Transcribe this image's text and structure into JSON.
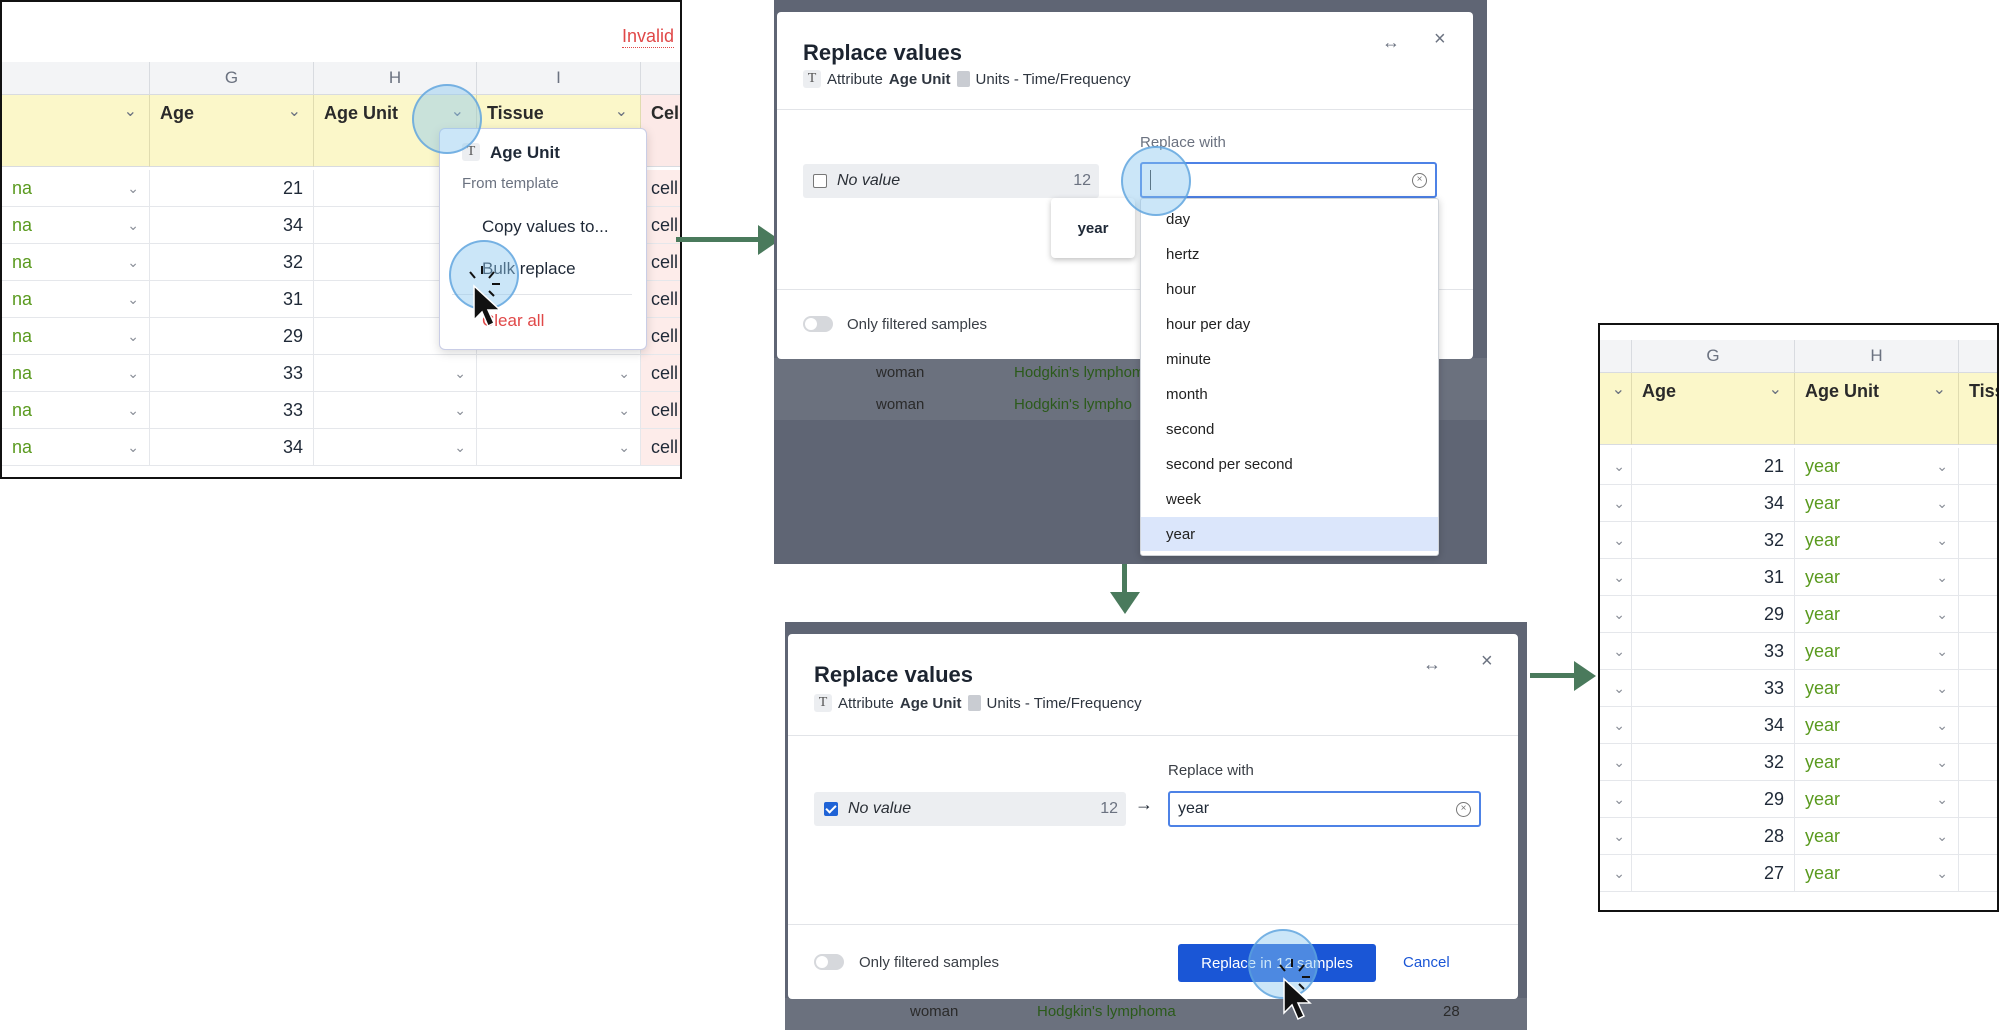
{
  "step1": {
    "banner": "Invalid",
    "columns": [
      {
        "letter": "G"
      },
      {
        "letter": "H"
      },
      {
        "letter": "I"
      }
    ],
    "headers": {
      "age": "Age",
      "age_unit": "Age Unit",
      "tissue": "Tissue",
      "cell": "Cell"
    },
    "rows": [
      {
        "prefix": "na",
        "age": "21",
        "cell": "cell"
      },
      {
        "prefix": "na",
        "age": "34",
        "cell": "cell"
      },
      {
        "prefix": "na",
        "age": "32",
        "cell": "cell"
      },
      {
        "prefix": "na",
        "age": "31",
        "cell": "cell"
      },
      {
        "prefix": "na",
        "age": "29",
        "cell": "cell"
      },
      {
        "prefix": "na",
        "age": "33",
        "cell": "cell"
      },
      {
        "prefix": "na",
        "age": "33",
        "cell": "cell"
      },
      {
        "prefix": "na",
        "age": "34",
        "cell": "cell"
      }
    ],
    "menu": {
      "title": "Age Unit",
      "subtitle": "From template",
      "copy": "Copy values to...",
      "bulk": "Bulk replace",
      "clear": "Clear all"
    }
  },
  "step2": {
    "title": "Replace values",
    "attr_label": "Attribute",
    "attr_name": "Age Unit",
    "units": "Units - Time/Frequency",
    "no_value": "No value",
    "count": "12",
    "replace_with": "Replace with",
    "tooltip": "year",
    "options": [
      "day",
      "hertz",
      "hour",
      "hour per day",
      "minute",
      "month",
      "second",
      "second per second",
      "week",
      "year"
    ],
    "selected_option": "year",
    "only_filtered": "Only filtered samples",
    "bg_rows": [
      {
        "gender": "woman",
        "disease": "Hodgkin's lymphoma"
      },
      {
        "gender": "woman",
        "disease": "Hodgkin's lympho"
      }
    ]
  },
  "step3": {
    "title": "Replace values",
    "attr_label": "Attribute",
    "attr_name": "Age Unit",
    "units": "Units - Time/Frequency",
    "no_value": "No value",
    "count": "12",
    "replace_with": "Replace with",
    "input_value": "year",
    "only_filtered": "Only filtered samples",
    "replace_button": "Replace in 12 samples",
    "cancel": "Cancel",
    "bg_row": {
      "gender": "woman",
      "disease": "Hodgkin's lymphoma",
      "age": "28"
    }
  },
  "step4": {
    "columns": [
      {
        "letter": "G"
      },
      {
        "letter": "H"
      }
    ],
    "headers": {
      "age": "Age",
      "age_unit": "Age Unit",
      "tissue": "Tiss"
    },
    "rows": [
      {
        "age": "21",
        "unit": "year"
      },
      {
        "age": "34",
        "unit": "year"
      },
      {
        "age": "32",
        "unit": "year"
      },
      {
        "age": "31",
        "unit": "year"
      },
      {
        "age": "29",
        "unit": "year"
      },
      {
        "age": "33",
        "unit": "year"
      },
      {
        "age": "33",
        "unit": "year"
      },
      {
        "age": "34",
        "unit": "year"
      },
      {
        "age": "32",
        "unit": "year"
      },
      {
        "age": "29",
        "unit": "year"
      },
      {
        "age": "28",
        "unit": "year"
      },
      {
        "age": "27",
        "unit": "year"
      }
    ]
  },
  "colors": {
    "accent": "#1a56d6",
    "green_text": "#5a9a1f",
    "danger": "#e04848",
    "arrow": "#4a7a5c",
    "header_yellow": "#fbf7c9"
  }
}
